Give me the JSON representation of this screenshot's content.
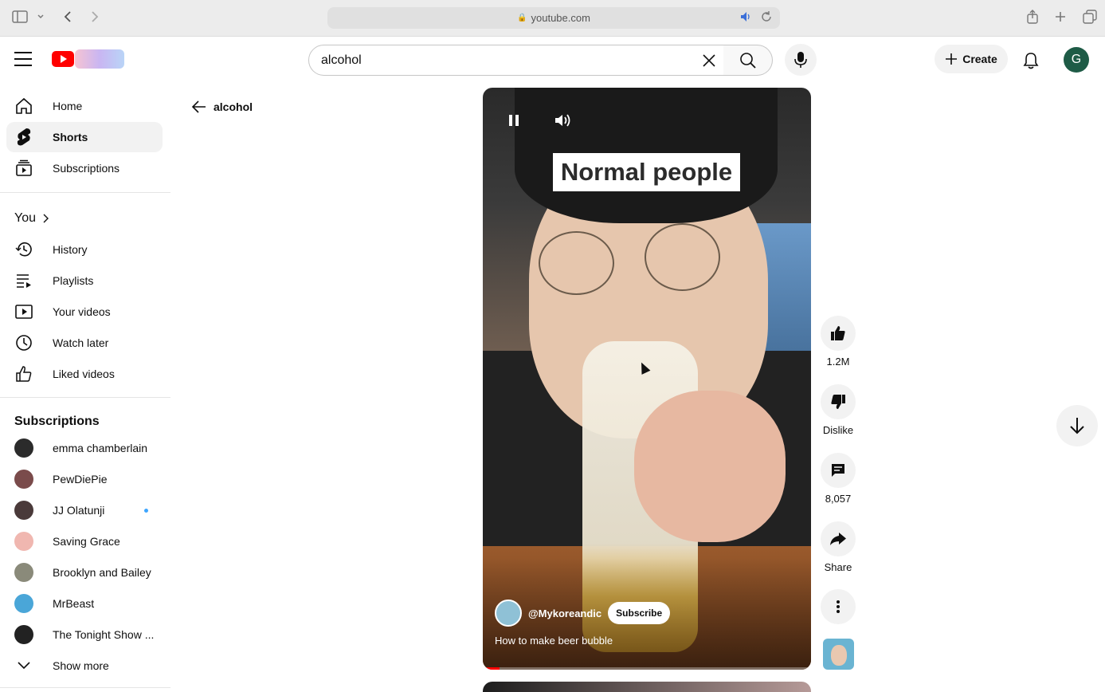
{
  "browser": {
    "url": "youtube.com"
  },
  "masthead": {
    "search_value": "alcohol",
    "create_label": "Create",
    "avatar_letter": "G"
  },
  "sidebar": {
    "main": [
      {
        "label": "Home",
        "icon": "home-icon"
      },
      {
        "label": "Shorts",
        "icon": "shorts-icon"
      },
      {
        "label": "Subscriptions",
        "icon": "subscriptions-icon"
      }
    ],
    "you_heading": "You",
    "you_items": [
      {
        "label": "History",
        "icon": "history-icon"
      },
      {
        "label": "Playlists",
        "icon": "playlists-icon"
      },
      {
        "label": "Your videos",
        "icon": "your-videos-icon"
      },
      {
        "label": "Watch later",
        "icon": "watch-later-icon"
      },
      {
        "label": "Liked videos",
        "icon": "liked-videos-icon"
      }
    ],
    "subscriptions_heading": "Subscriptions",
    "subscriptions": [
      {
        "label": "emma chamberlain",
        "color": "#2b2b2b"
      },
      {
        "label": "PewDiePie",
        "color": "#7a4b4b"
      },
      {
        "label": "JJ Olatunji",
        "color": "#4a3a3a"
      },
      {
        "label": "Saving Grace",
        "color": "#f0b7b0"
      },
      {
        "label": "Brooklyn and Bailey",
        "color": "#8a8a7a"
      },
      {
        "label": "MrBeast",
        "color": "#4aa6d8"
      },
      {
        "label": "The Tonight Show ...",
        "color": "#222222"
      }
    ],
    "show_more": "Show more"
  },
  "back_link": "alcohol",
  "video": {
    "caption": "Normal people",
    "channel": "@Mykoreandic",
    "subscribe_label": "Subscribe",
    "title": "How to make beer bubble",
    "progress": 0.05
  },
  "actions": {
    "likes": "1.2M",
    "dislike_label": "Dislike",
    "comments": "8,057",
    "share_label": "Share"
  },
  "colors": {
    "brand_red": "#ff0000",
    "avatar_green": "#1e5b46",
    "live_dot": "#3ea6ff"
  }
}
